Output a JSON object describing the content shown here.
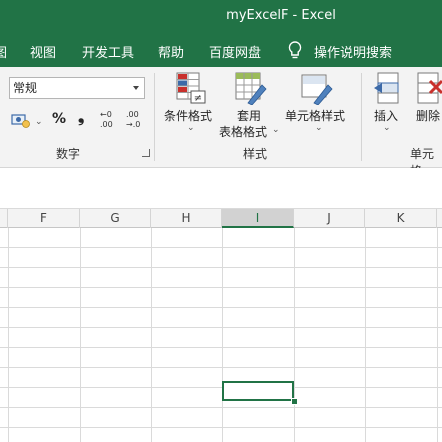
{
  "window": {
    "title": "myExcelF  -  Excel"
  },
  "menu": {
    "items": [
      {
        "label": "图"
      },
      {
        "label": "视图"
      },
      {
        "label": "开发工具"
      },
      {
        "label": "帮助"
      },
      {
        "label": "百度网盘"
      }
    ],
    "tell_me": "操作说明搜索"
  },
  "ribbon": {
    "number": {
      "format_value": "常规",
      "percent": "%",
      "comma": "❟",
      "inc_decimal_top": "←0",
      "inc_decimal_bottom": ".00",
      "dec_decimal_top": ".00",
      "dec_decimal_bottom": "→.0",
      "group_label": "数字"
    },
    "styles": {
      "conditional_formatting": "条件格式",
      "format_as_table_line1": "套用",
      "format_as_table_line2": "表格格式",
      "cell_styles": "单元格样式",
      "group_label": "样式"
    },
    "cells": {
      "insert": "插入",
      "delete": "删除",
      "group_label": "单元格"
    }
  },
  "sheet": {
    "columns": [
      "F",
      "G",
      "H",
      "I",
      "J",
      "K"
    ],
    "selected_column": "I",
    "active_cell": "I"
  },
  "colors": {
    "accent": "#217346"
  }
}
